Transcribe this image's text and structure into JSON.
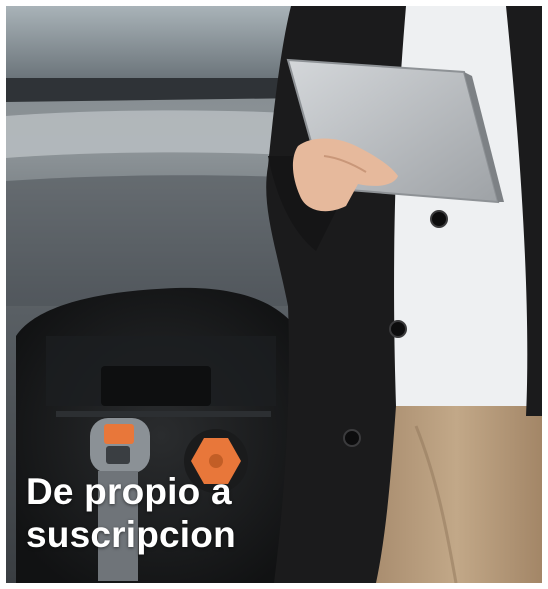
{
  "caption": {
    "line1": "De propio a",
    "line2": "suscripcion"
  },
  "scene": {
    "car_color": "#5a5f63",
    "coat_color": "#1b1b1c",
    "shirt_color": "#eef0f2",
    "trousers_color": "#b59a7c",
    "tablet_color": "#b9bcbf",
    "charger_accent": "#e8773a",
    "text_color": "#ffffff"
  },
  "icons": {
    "tablet": "tablet-icon",
    "charging_port": "charging-port-icon"
  }
}
